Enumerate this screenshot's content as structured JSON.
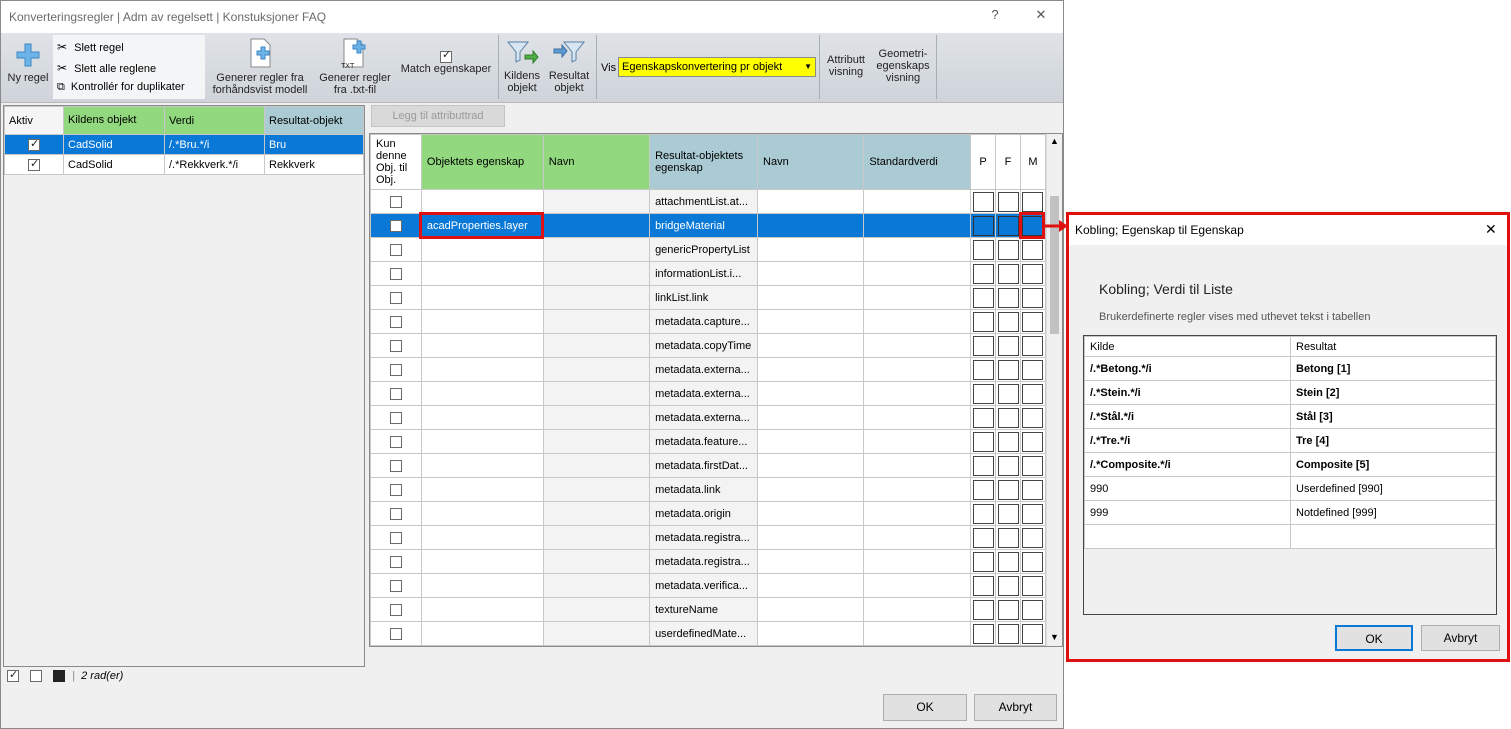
{
  "window": {
    "title": "Konverteringsregler | Adm av regelsett | Konstuksjoner FAQ",
    "help": "?",
    "close": "✕"
  },
  "ribbon": {
    "new_rule": "Ny regel",
    "delete_rule": "Slett regel",
    "delete_all": "Slett alle reglene",
    "check_duplicates": "Kontrollér for duplikater",
    "generate_model": "Generer regler fra forhåndsvist modell",
    "generate_txt": "Generer regler fra .txt-fil",
    "txt_badge": "TXT",
    "match_properties": "Match egenskaper",
    "source_object": "Kildens objekt",
    "result_object": "Resultat objekt",
    "vis_label": "Vis",
    "vis_value": "Egenskapskonvertering pr objekt",
    "attribute_view": "Attributt visning",
    "geometry_view": "Geometri-egenskaps visning"
  },
  "left_grid": {
    "headers": [
      "Aktiv",
      "Kildens objekt",
      "Verdi",
      "Resultat-objekt"
    ],
    "rows": [
      {
        "active": true,
        "source": "CadSolid",
        "value": "/.*Bru.*/i",
        "result": "Bru"
      },
      {
        "active": true,
        "source": "CadSolid",
        "value": "/.*Rekkverk.*/i",
        "result": "Rekkverk"
      }
    ]
  },
  "add_attribute_row": "Legg til attributtrad",
  "right_grid": {
    "headers": [
      "Kun denne Obj. til Obj.",
      "Objektets egenskap",
      "Navn",
      "Resultat-objektets egenskap",
      "Navn",
      "Standardverdi",
      "P",
      "F",
      "M"
    ],
    "rows": [
      {
        "prop": "",
        "result": "attachmentList.at..."
      },
      {
        "prop": "acadProperties.layer",
        "result": "bridgeMaterial"
      },
      {
        "prop": "",
        "result": "genericPropertyList"
      },
      {
        "prop": "",
        "result": "informationList.i..."
      },
      {
        "prop": "",
        "result": "linkList.link"
      },
      {
        "prop": "",
        "result": "metadata.capture..."
      },
      {
        "prop": "",
        "result": "metadata.copyTime"
      },
      {
        "prop": "",
        "result": "metadata.externa..."
      },
      {
        "prop": "",
        "result": "metadata.externa..."
      },
      {
        "prop": "",
        "result": "metadata.externa..."
      },
      {
        "prop": "",
        "result": "metadata.feature..."
      },
      {
        "prop": "",
        "result": "metadata.firstDat..."
      },
      {
        "prop": "",
        "result": "metadata.link"
      },
      {
        "prop": "",
        "result": "metadata.origin"
      },
      {
        "prop": "",
        "result": "metadata.registra..."
      },
      {
        "prop": "",
        "result": "metadata.registra..."
      },
      {
        "prop": "",
        "result": "metadata.verifica..."
      },
      {
        "prop": "",
        "result": "textureName"
      },
      {
        "prop": "",
        "result": "userdefinedMate..."
      }
    ]
  },
  "status": {
    "rows": "2 rad(er)"
  },
  "buttons": {
    "ok": "OK",
    "cancel": "Avbryt"
  },
  "dialog": {
    "title": "Kobling; Egenskap til Egenskap",
    "heading": "Kobling; Verdi til Liste",
    "subtitle": "Brukerdefinerte regler vises med uthevet tekst i tabellen",
    "headers": [
      "Kilde",
      "Resultat"
    ],
    "rows": [
      {
        "source": "/.*Betong.*/i",
        "result": "Betong [1]",
        "bold": true
      },
      {
        "source": "/.*Stein.*/i",
        "result": "Stein [2]",
        "bold": true
      },
      {
        "source": "/.*Stål.*/i",
        "result": "Stål [3]",
        "bold": true
      },
      {
        "source": "/.*Tre.*/i",
        "result": "Tre [4]",
        "bold": true
      },
      {
        "source": "/.*Composite.*/i",
        "result": "Composite [5]",
        "bold": true
      },
      {
        "source": "990",
        "result": "Userdefined [990]",
        "bold": false
      },
      {
        "source": "999",
        "result": "Notdefined [999]",
        "bold": false
      },
      {
        "source": "",
        "result": "",
        "bold": false
      }
    ],
    "ok": "OK",
    "cancel": "Avbryt",
    "close": "✕"
  },
  "colors": {
    "accent": "#0a78d7",
    "highlight": "#e01010",
    "green_header": "#91d87e",
    "teal_header": "#aacbd3",
    "vis_bg": "#ffff00"
  }
}
